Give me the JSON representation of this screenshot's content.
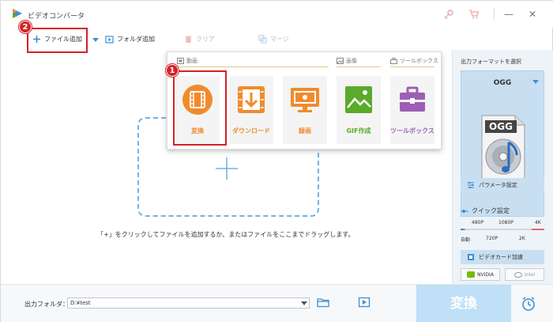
{
  "app": {
    "title": "ビデオコンバータ"
  },
  "toolbar": {
    "add_file": "ファイル追加",
    "add_folder": "フォルダ追加",
    "clear": "クリア",
    "merge": "マージ"
  },
  "drop": {
    "hint": "「+」をクリックしてファイルを追加するか、またはファイルをここまでドラッグします。"
  },
  "popup": {
    "categories": {
      "video": "動画",
      "image": "画像",
      "toolbox": "ツールボックス"
    },
    "tiles": [
      {
        "label": "変換",
        "icon": "film-convert-icon",
        "color": "#f08b2c"
      },
      {
        "label": "ダウンロード",
        "icon": "download-icon",
        "color": "#f08b2c"
      },
      {
        "label": "録画",
        "icon": "screen-record-icon",
        "color": "#f08b2c"
      },
      {
        "label": "GIF作成",
        "icon": "gif-image-icon",
        "color": "#5aaa2c"
      },
      {
        "label": "ツールボックス",
        "icon": "toolbox-icon",
        "color": "#9c5fb5"
      }
    ]
  },
  "badges": {
    "one": "1",
    "two": "2"
  },
  "side": {
    "title": "出力フォーマットを選択",
    "format": "OGG",
    "format_art_label": "OGG",
    "param_settings": "パラメータ設定",
    "quick_settings": "クイック設定",
    "quality_top": [
      "480P",
      "1080P",
      "4K"
    ],
    "quality_bottom": [
      "自動",
      "720P",
      "2K"
    ],
    "gpu_accel": "ビデオカード加速",
    "nvidia": "NVIDIA",
    "intel": "Intel"
  },
  "bottom": {
    "output_label": "出力フォルダ：",
    "output_path": "D:¥test",
    "convert": "変換"
  },
  "colors": {
    "accent": "#3a8fd3",
    "marker": "#d52027",
    "orange": "#f08b2c"
  }
}
